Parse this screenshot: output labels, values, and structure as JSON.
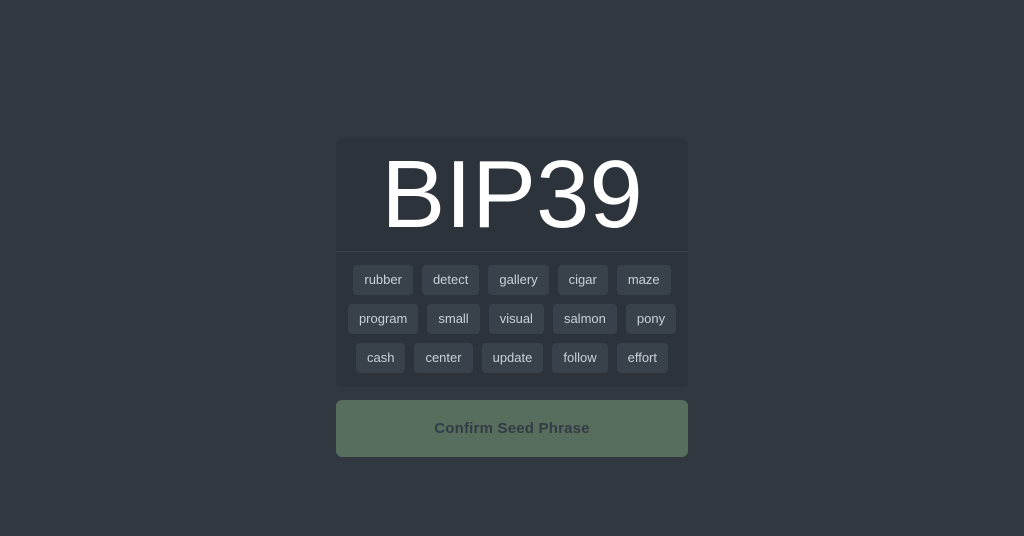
{
  "page": {
    "background_color": "#31383f"
  },
  "card": {
    "background_color": "#2c333b",
    "title": "BIP39",
    "divider_color": "#3b434c",
    "chip": {
      "background_color": "#39414a",
      "text_color": "#c9d0d7"
    },
    "word_rows": [
      [
        "rubber",
        "detect",
        "gallery",
        "cigar",
        "maze"
      ],
      [
        "program",
        "small",
        "visual",
        "salmon",
        "pony"
      ],
      [
        "cash",
        "center",
        "update",
        "follow",
        "effort"
      ]
    ],
    "words": [
      "rubber",
      "detect",
      "gallery",
      "cigar",
      "maze",
      "program",
      "small",
      "visual",
      "salmon",
      "pony",
      "cash",
      "center",
      "update",
      "follow",
      "effort"
    ],
    "word_count": 15
  },
  "confirm_button": {
    "label": "Confirm Seed Phrase",
    "background_color": "#576e5e",
    "text_color": "#333c44"
  }
}
